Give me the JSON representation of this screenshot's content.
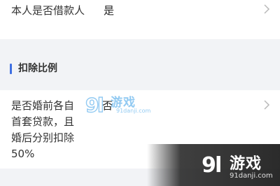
{
  "rows": [
    {
      "label": "本人是否借款人",
      "value": "是"
    },
    {
      "label": "是否婚前各自首套贷款，且婚后分别扣除50%",
      "value": "否"
    }
  ],
  "section": {
    "title": "扣除比例"
  },
  "icons": {
    "row_chevron": "chevron-right-icon"
  },
  "watermark": {
    "brand": "91游戏",
    "logo_text": "游戏",
    "site": "91danji.com"
  },
  "colors": {
    "accent": "#3f6fe2",
    "page_bg": "#f2f3f6",
    "card_bg": "#ffffff"
  }
}
